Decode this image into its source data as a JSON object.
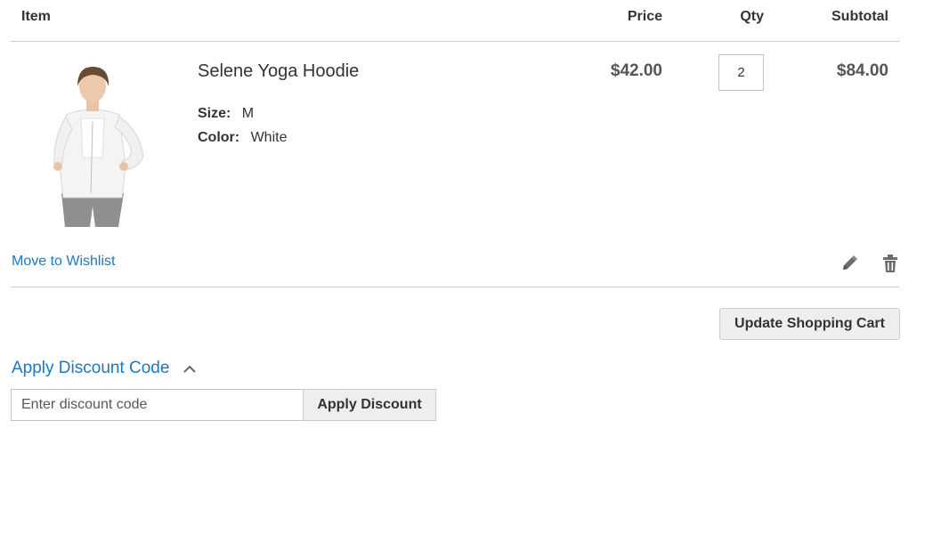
{
  "table_headers": {
    "item": "Item",
    "price": "Price",
    "qty": "Qty",
    "subtotal": "Subtotal"
  },
  "cart_item": {
    "name": "Selene Yoga Hoodie",
    "image_icon": "product-photo",
    "options": [
      {
        "label": "Size:",
        "value": "M"
      },
      {
        "label": "Color:",
        "value": "White"
      }
    ],
    "price": "$42.00",
    "qty": "2",
    "subtotal": "$84.00",
    "move_to_wishlist": "Move to Wishlist",
    "edit_icon": "pencil-icon",
    "delete_icon": "trash-icon"
  },
  "actions": {
    "update_cart": "Update Shopping Cart"
  },
  "discount": {
    "title": "Apply Discount Code",
    "placeholder": "Enter discount code",
    "button": "Apply Discount",
    "expanded_icon": "chevron-up-icon"
  },
  "colors": {
    "link": "#1979c3",
    "text": "#333333",
    "border": "#cccccc",
    "button_bg": "#eeeeee"
  }
}
